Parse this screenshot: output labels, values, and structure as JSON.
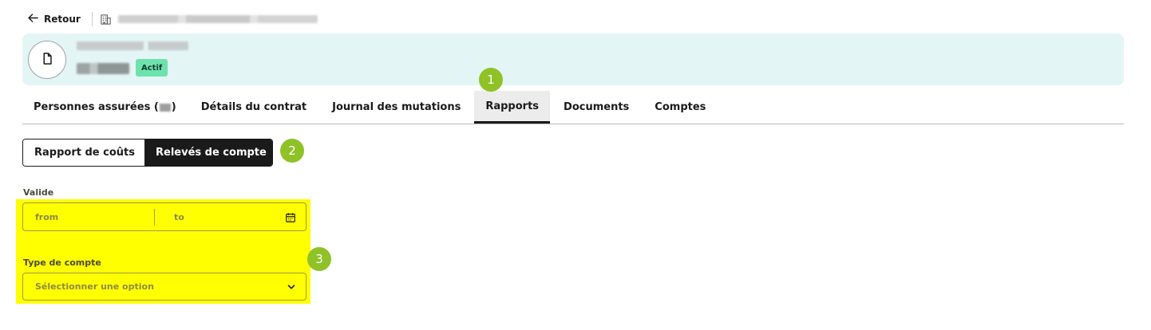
{
  "topbar": {
    "back_label": "Retour"
  },
  "header": {
    "status_badge": "Actif"
  },
  "tabs": [
    {
      "label_prefix": "Personnes assurées (",
      "label_suffix": ")"
    },
    {
      "label": "Détails du contrat"
    },
    {
      "label": "Journal des mutations"
    },
    {
      "label": "Rapports"
    },
    {
      "label": "Documents"
    },
    {
      "label": "Comptes"
    }
  ],
  "active_tab": "Rapports",
  "report_toggle": {
    "options": [
      "Rapport de coûts",
      "Relevés de compte"
    ],
    "selected": "Relevés de compte"
  },
  "steps": [
    "1",
    "2",
    "3"
  ],
  "filters": {
    "valid_label": "Valide",
    "from_placeholder": "from",
    "to_placeholder": "to",
    "account_type_label": "Type de compte",
    "account_type_placeholder": "Sélectionner une option"
  },
  "colors": {
    "header_bg": "#e4f5f5",
    "badge_bg": "#6ee2ae",
    "step_marker": "#8fc227",
    "highlight": "#ffff00",
    "active_toggle_bg": "#1a1a1a"
  },
  "icons": [
    "arrow-left-icon",
    "building-icon",
    "document-icon",
    "calendar-icon",
    "chevron-down-icon"
  ]
}
